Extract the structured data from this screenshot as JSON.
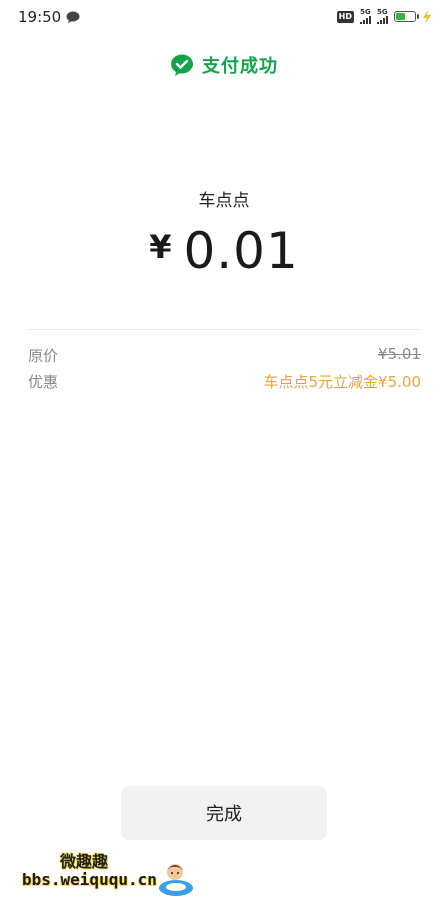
{
  "status_bar": {
    "time": "19:50",
    "network1": "5G",
    "network2": "5G",
    "hd": "HD"
  },
  "header": {
    "title": "支付成功",
    "brand_color": "#13a34a"
  },
  "payment": {
    "merchant": "车点点",
    "currency": "¥",
    "amount": "0.01"
  },
  "details": {
    "original_label": "原价",
    "original_value": "¥5.01",
    "discount_label": "优惠",
    "discount_value": "车点点5元立减金¥5.00",
    "discount_color": "#e8a33d"
  },
  "actions": {
    "done_label": "完成"
  },
  "watermark": {
    "line1": "微趣趣",
    "line2": "bbs.weiququ.cn"
  }
}
